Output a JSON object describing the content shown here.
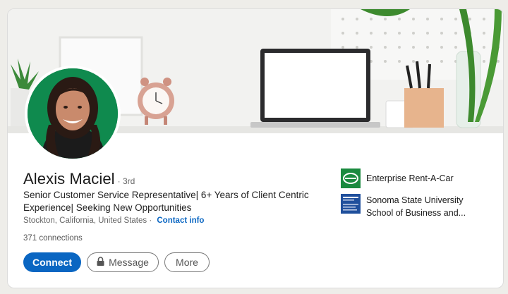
{
  "profile": {
    "name": "Alexis Maciel",
    "degree": "· 3rd",
    "headline": "Senior Customer Service Representative| 6+ Years of Client Centric Experience| Seeking New Opportunities",
    "location": "Stockton, California, United States ·",
    "contact_label": "Contact info",
    "connections": "371 connections"
  },
  "actions": {
    "connect": "Connect",
    "message": "Message",
    "more": "More"
  },
  "experience": {
    "company": "Enterprise Rent-A-Car",
    "school_line1": "Sonoma State University",
    "school_line2": "School of Business and..."
  },
  "icons": {
    "lock": "lock-icon",
    "company_logo": "enterprise-logo",
    "school_logo": "sonoma-state-logo"
  },
  "colors": {
    "accent": "#0a66c2",
    "enterprise_green": "#1a8a3f",
    "sonoma_blue": "#1f4f9c"
  }
}
